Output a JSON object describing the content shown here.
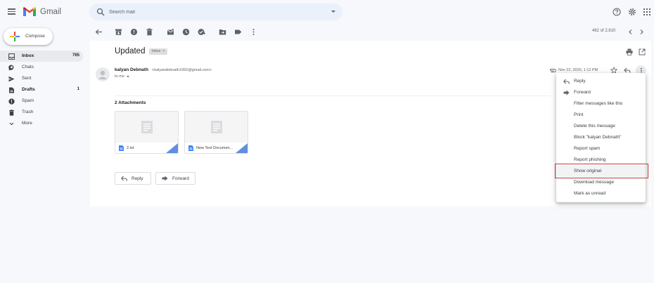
{
  "app": {
    "name": "Gmail"
  },
  "search": {
    "placeholder": "Search mail"
  },
  "compose": {
    "label": "Compose"
  },
  "sidebar": {
    "items": [
      {
        "label": "Inbox",
        "count": "765",
        "icon": "inbox-icon"
      },
      {
        "label": "Chats",
        "count": "",
        "icon": "chat-icon"
      },
      {
        "label": "Sent",
        "count": "",
        "icon": "send-icon"
      },
      {
        "label": "Drafts",
        "count": "1",
        "icon": "draft-icon"
      },
      {
        "label": "Spam",
        "count": "",
        "icon": "spam-icon"
      },
      {
        "label": "Trash",
        "count": "",
        "icon": "trash-icon"
      },
      {
        "label": "More",
        "count": "",
        "icon": "chevron-down-icon"
      }
    ]
  },
  "toolbar": {
    "pager": "462 of 2,610"
  },
  "email": {
    "subject": "Updated",
    "label": "Inbox",
    "sender_name": "kalyan Debnath",
    "sender_email": "<kalyandebnath1992@gmail.com>",
    "to": "to me",
    "date": "Nov 22, 2020, 1:12 PM",
    "attachments_title": "2 Attachments",
    "attachments": [
      {
        "name": "2.txt"
      },
      {
        "name": "New Text Documen..."
      }
    ],
    "reply_label": "Reply",
    "forward_label": "Forward"
  },
  "menu": {
    "items": [
      {
        "label": "Reply",
        "icon": "reply-icon"
      },
      {
        "label": "Forward",
        "icon": "forward-icon"
      },
      {
        "label": "Filter messages like this",
        "icon": ""
      },
      {
        "label": "Print",
        "icon": ""
      },
      {
        "label": "Delete this message",
        "icon": ""
      },
      {
        "label": "Block \"kalyan Debnath\"",
        "icon": ""
      },
      {
        "label": "Report spam",
        "icon": ""
      },
      {
        "label": "Report phishing",
        "icon": ""
      },
      {
        "label": "Show original",
        "icon": ""
      },
      {
        "label": "Download message",
        "icon": ""
      },
      {
        "label": "Mark as unread",
        "icon": ""
      }
    ],
    "highlighted": "Show original",
    "highlight_color": "#c53b3b"
  }
}
